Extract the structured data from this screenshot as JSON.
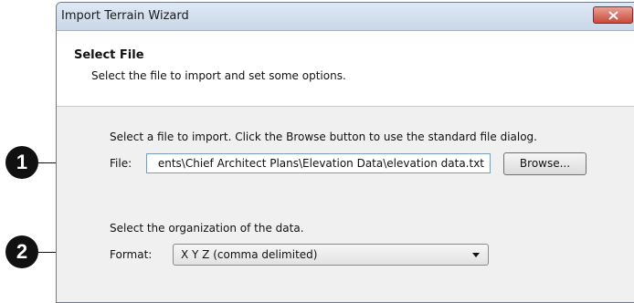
{
  "window": {
    "title": "Import Terrain Wizard"
  },
  "header": {
    "title": "Select File",
    "subtitle": "Select the file to import and set some options."
  },
  "file_section": {
    "instruction": "Select a file to import. Click the Browse button to use the standard file dialog.",
    "label": "File:",
    "value": "ents\\Chief Architect Plans\\Elevation Data\\elevation data.txt",
    "browse_label": "Browse..."
  },
  "format_section": {
    "instruction": "Select the organization of the data.",
    "label": "Format:",
    "selected": "X Y Z (comma delimited)"
  },
  "callouts": [
    "1",
    "2"
  ],
  "icons": {
    "close": "close-icon",
    "dropdown": "chevron-down-icon"
  },
  "colors": {
    "close_button": "#c9493a",
    "titlebar": "#dfe9f5"
  }
}
